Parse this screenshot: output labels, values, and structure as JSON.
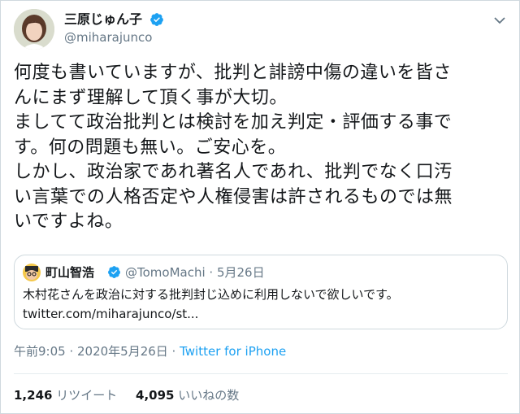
{
  "author": {
    "name": "三原じゅん子",
    "handle": "@miharajunco"
  },
  "tweet": {
    "text": "何度も書いていますが、批判と誹謗中傷の違いを皆さ\nんにまず理解して頂く事が大切。\nましてて政治批判とは検討を加え判定・評価する事で\nす。何の問題も無い。ご安心を。\nしかし、政治家であれ著名人であれ、批判でなく口汚\nい言葉での人格否定や人権侵害は許されるものでは無\nいですよね。"
  },
  "quoted": {
    "name": "町山智浩",
    "handle": "@TomoMachi · 5月26日",
    "text": "木村花さんを政治に対する批判封じ込めに利用しないで欲しいです。",
    "link": "twitter.com/miharajunco/st..."
  },
  "meta": {
    "time": "午前9:05 · 2020年5月26日 · ",
    "source": "Twitter for iPhone"
  },
  "stats": {
    "retweets_count": "1,246",
    "retweets_label": "リツイート",
    "likes_count": "4,095",
    "likes_label": "いいねの数"
  },
  "colors": {
    "accent": "#1da1f2",
    "secondary_text": "#657786",
    "border": "#cfd9de"
  }
}
